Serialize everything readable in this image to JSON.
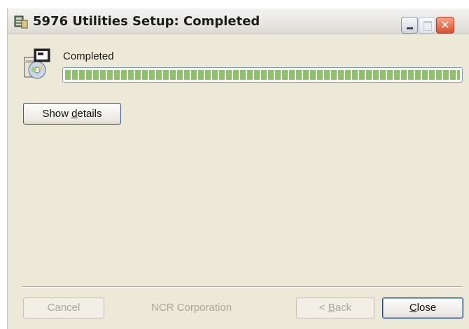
{
  "window": {
    "title": "5976 Utilities Setup: Completed"
  },
  "status": {
    "label": "Completed",
    "progress": 1.0
  },
  "buttons": {
    "show_details_prefix": "Show ",
    "show_details_accel": "d",
    "show_details_suffix": "etails",
    "cancel": "Cancel",
    "back_prefix": "< ",
    "back_accel": "B",
    "back_suffix": "ack",
    "close_accel": "C",
    "close_suffix": "lose"
  },
  "branding": "NCR Corporation",
  "colors": {
    "progress_segment": "#8ec26a",
    "window_face": "#ece9d8",
    "close_button_red": "#d9502f"
  },
  "icons": [
    "setup-app-icon",
    "minimize-icon",
    "maximize-icon",
    "close-icon",
    "installer-package-icon"
  ]
}
